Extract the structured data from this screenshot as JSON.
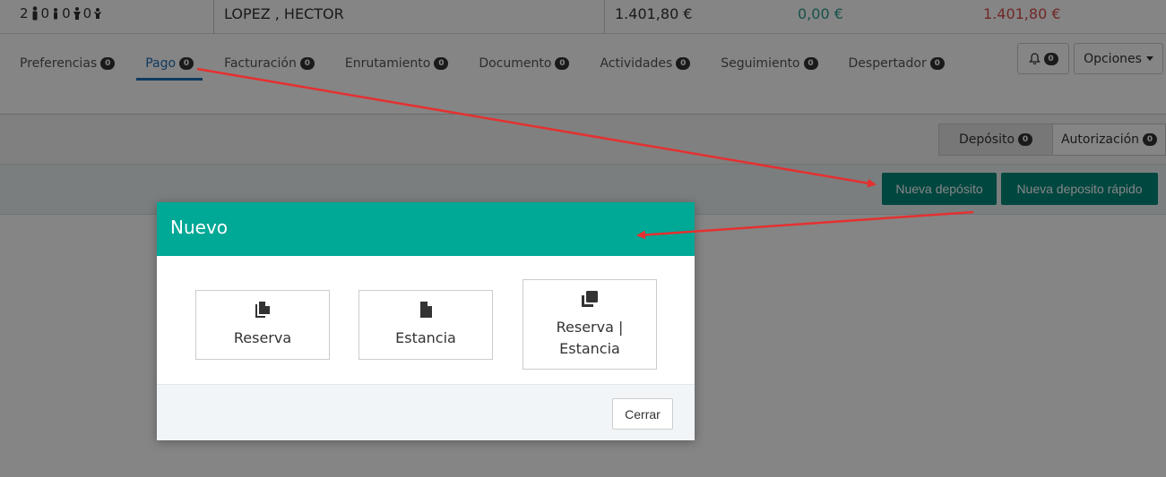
{
  "summary": {
    "adults": "2",
    "children": "0",
    "teens": "0",
    "babies": "0",
    "infants": "0",
    "guest_name": "LOPEZ , HECTOR",
    "total": "1.401,80 €",
    "paid": "0,00 €",
    "balance": "1.401,80 €",
    "colors": {
      "paid": "#2a9d8f",
      "balance": "#d94b4b"
    }
  },
  "tabs": [
    {
      "label": "Preferencias",
      "count": "0"
    },
    {
      "label": "Pago",
      "count": "0",
      "active": true
    },
    {
      "label": "Facturación",
      "count": "0"
    },
    {
      "label": "Enrutamiento",
      "count": "0"
    },
    {
      "label": "Documento",
      "count": "0"
    },
    {
      "label": "Actividades",
      "count": "0"
    },
    {
      "label": "Seguimiento",
      "count": "0"
    },
    {
      "label": "Despertador",
      "count": "0"
    }
  ],
  "toolbar": {
    "notifications_count": "0",
    "options_label": "Opciones"
  },
  "subtabs": [
    {
      "label": "Depósito",
      "count": "0",
      "active": true
    },
    {
      "label": "Autorización",
      "count": "0"
    }
  ],
  "actions": {
    "new_deposit": "Nueva depósito",
    "new_quick_deposit": "Nueva deposito rápido"
  },
  "modal": {
    "title": "Nuevo",
    "choices": [
      {
        "label": "Reserva",
        "icon": "copy-icon"
      },
      {
        "label": "Estancia",
        "icon": "file-icon"
      },
      {
        "label": "Reserva | Estancia",
        "icon": "clone-icon"
      }
    ],
    "close_label": "Cerrar"
  },
  "colors": {
    "accent": "#00a896",
    "button_teal": "#00897b",
    "tab_active": "#1f6fb5",
    "annotation_arrow": "#e53030"
  }
}
